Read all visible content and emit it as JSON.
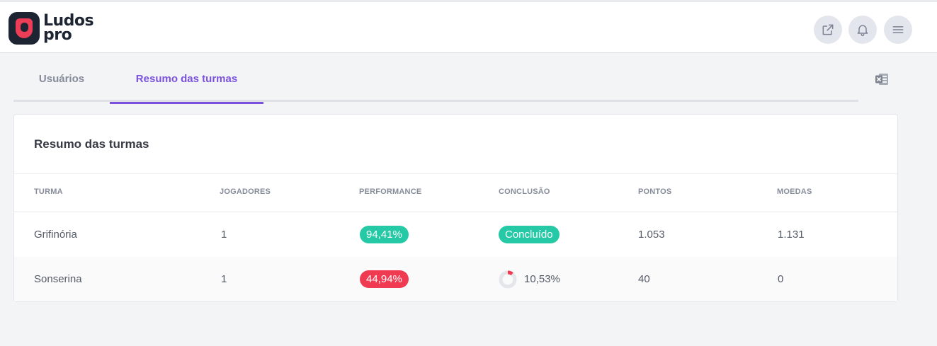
{
  "brand": {
    "line1": "Ludos",
    "line2": "pro"
  },
  "header": {
    "actions": [
      "external-link",
      "notifications",
      "menu"
    ]
  },
  "tabs": [
    {
      "label": "Usuários",
      "active": false
    },
    {
      "label": "Resumo das turmas",
      "active": true
    }
  ],
  "export_icon": "excel-icon",
  "card": {
    "title": "Resumo das turmas",
    "columns": [
      "TURMA",
      "JOGADORES",
      "PERFORMANCE",
      "CONCLUSÃO",
      "PONTOS",
      "MOEDAS"
    ],
    "rows": [
      {
        "turma": "Grifinória",
        "jogadores": "1",
        "performance": "94,41%",
        "performance_status": "good",
        "conclusao": "Concluído",
        "conclusao_fraction": 1.0,
        "pontos": "1.053",
        "moedas": "1.131"
      },
      {
        "turma": "Sonserina",
        "jogadores": "1",
        "performance": "44,94%",
        "performance_status": "bad",
        "conclusao": "10,53%",
        "conclusao_fraction": 0.1053,
        "pontos": "40",
        "moedas": "0"
      }
    ]
  },
  "colors": {
    "accent": "#7b52dd",
    "success": "#25c9a5",
    "danger": "#f03a52",
    "brand_dark": "#1d2533",
    "brand_red": "#ee3d57"
  }
}
